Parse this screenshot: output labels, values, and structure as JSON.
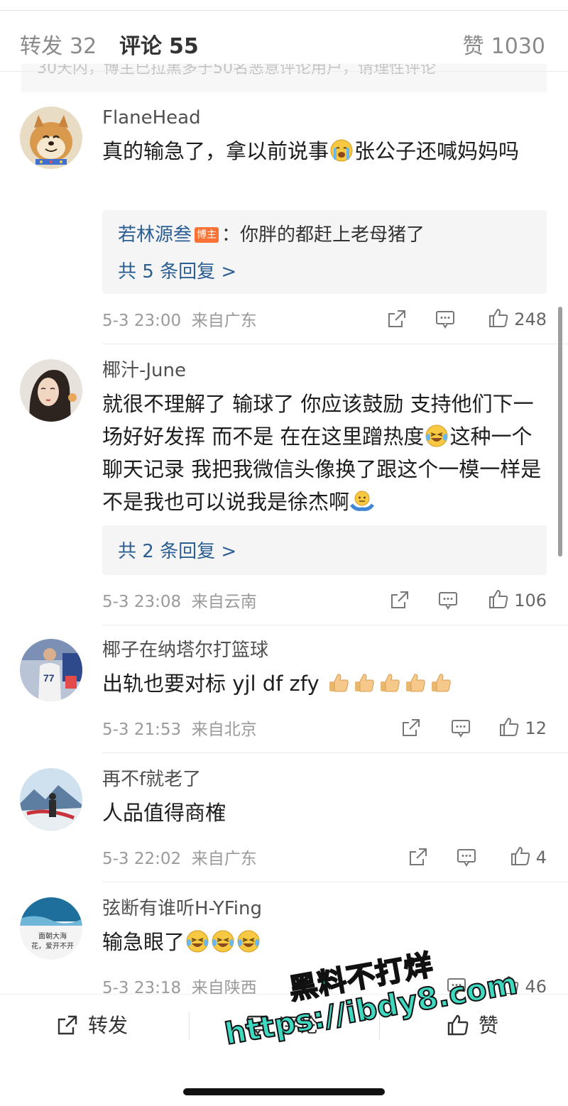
{
  "tabs": {
    "repost_label": "转发",
    "repost_count": "32",
    "comment_label": "评论",
    "comment_count": "55",
    "like_label": "赞",
    "like_count": "1030"
  },
  "notice": "30天内，博主已拉黑多于50名恶意评论用户，请理性评论",
  "comments": [
    {
      "username": "FlaneHead",
      "text_a": "真的输急了，拿以前说事",
      "emoji_a": "crying-face-emoji",
      "text_b": "张公子还喊妈妈吗",
      "reply_user": "若林源叁",
      "reply_badge": "博主",
      "reply_text": "：你胖的都赶上老母猪了",
      "reply_more": "共 5 条回复 >",
      "time": "5-3 23:00",
      "location": "来自广东",
      "likes": "248"
    },
    {
      "username": "椰汁-June",
      "text_a": "就很不理解了  输球了 你应该鼓励 支持他们下一场好好发挥 而不是 在在这里蹭热度",
      "emoji_a": "laughing-crying-emoji",
      "text_b": "这种一个聊天记录 我把我微信头像换了跟这个一模一样是不是我也可以说我是徐杰啊",
      "emoji_b": "shrug-emoji",
      "reply_more": "共 2 条回复 >",
      "time": "5-3 23:08",
      "location": "来自云南",
      "likes": "106"
    },
    {
      "username": "椰子在纳塔尔打篮球",
      "text_a": "出轨也要对标 yjl df zfy",
      "emoji_a": "thumbs-up-emoji x5",
      "time": "5-3 21:53",
      "location": "来自北京",
      "likes": "12"
    },
    {
      "username": "再不f就老了",
      "text_a": "人品值得商榷",
      "time": "5-3 22:02",
      "location": "来自广东",
      "likes": "4"
    },
    {
      "username": "弦断有谁听H-YFing",
      "text_a": "输急眼了",
      "emoji_a": "laughing-crying-emoji x3",
      "avatar_text_1": "面朝大海",
      "avatar_text_2": "花，爱开不开",
      "time": "5-3 23:18",
      "location": "来自陕西",
      "likes": "46"
    }
  ],
  "bottom_bar": {
    "repost_label": "转发",
    "comment_label": "评论",
    "like_label": "赞"
  },
  "watermark": {
    "line1": "黑料不打烊",
    "line2": "https://ibdy8.com"
  },
  "colors": {
    "link_blue": "#2b5f94",
    "badge_orange": "#f77234",
    "watermark_teal": "#3fd8c0"
  }
}
